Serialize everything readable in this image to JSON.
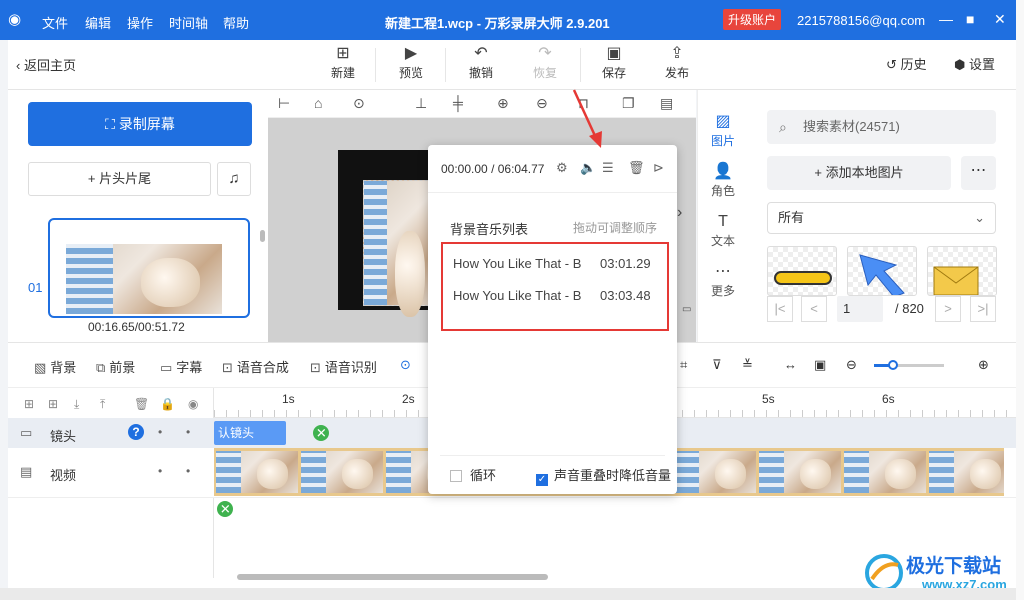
{
  "window": {
    "menus": [
      "文件",
      "编辑",
      "操作",
      "时间轴",
      "帮助"
    ],
    "title": "新建工程1.wcp - 万彩录屏大师 2.9.201",
    "upgrade": "升级账户",
    "account": "2215788156@qq.com"
  },
  "toolbar": {
    "back": "返回主页",
    "new": "新建",
    "preview": "预览",
    "undo": "撤销",
    "redo": "恢复",
    "save": "保存",
    "publish": "发布",
    "history": "历史",
    "settings": "设置"
  },
  "left": {
    "record": "录制屏幕",
    "head_tail": "片头片尾",
    "clip_index": "01",
    "clip_time": "00:16.65/00:51.72"
  },
  "side_tabs": [
    "图片",
    "角色",
    "文本",
    "更多"
  ],
  "material": {
    "search": "搜索素材(24571)",
    "add_local": "添加本地图片",
    "filter": "所有",
    "page": "1",
    "page_total": "/ 820"
  },
  "timeline_tools": {
    "background": "背景",
    "foreground": "前景",
    "subtitle": "字幕",
    "tts": "语音合成",
    "asr": "语音识别"
  },
  "ruler": [
    "1s",
    "2s",
    "5s",
    "6s"
  ],
  "tracks": {
    "lens": "镜头",
    "lens_clip": "认镜头",
    "video": "视频"
  },
  "popup": {
    "current": "00:00.00",
    "separator": "/",
    "total": "06:04.77",
    "list_title": "背景音乐列表",
    "list_hint": "拖动可调整顺序",
    "tracks": [
      {
        "name": "How You Like That - B",
        "duration": "03:01.29"
      },
      {
        "name": "How You Like That - B",
        "duration": "03:03.48"
      }
    ],
    "loop": "循环",
    "duck": "声音重叠时降低音量",
    "duck_checked": true
  },
  "watermark": {
    "name": "极光下载站",
    "url": "www.xz7.com"
  },
  "colors": {
    "accent": "#1f6fe0",
    "highlight": "#e53935",
    "upgrade": "#e8453c"
  }
}
